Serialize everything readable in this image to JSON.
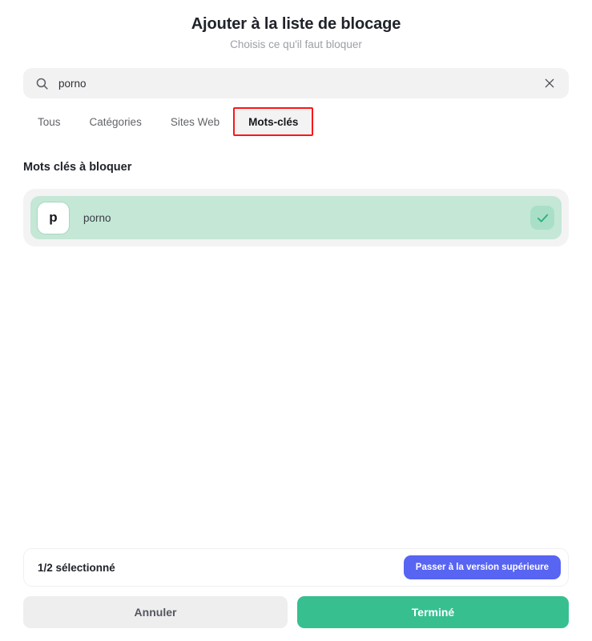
{
  "header": {
    "title": "Ajouter à la liste de blocage",
    "subtitle": "Choisis ce qu'il faut bloquer"
  },
  "search": {
    "value": "porno",
    "placeholder": "Rechercher",
    "search_icon": "search-icon",
    "clear_icon": "close-icon"
  },
  "tabs": [
    {
      "label": "Tous",
      "active": false
    },
    {
      "label": "Catégories",
      "active": false
    },
    {
      "label": "Sites Web",
      "active": false
    },
    {
      "label": "Mots-clés",
      "active": true
    }
  ],
  "section": {
    "title": "Mots clés à bloquer",
    "items": [
      {
        "avatar_letter": "p",
        "label": "porno",
        "selected": true,
        "check_icon": "check-icon"
      }
    ]
  },
  "footer": {
    "status_text": "1/2 sélectionné",
    "upgrade_label": "Passer à la version supérieure",
    "cancel_label": "Annuler",
    "done_label": "Terminé"
  },
  "colors": {
    "accent_green": "#37bf90",
    "accent_blue": "#5864f2",
    "row_selected_bg": "#c4e7d6",
    "annotation_red": "#fb1717",
    "neutral_bg": "#f2f2f3"
  }
}
